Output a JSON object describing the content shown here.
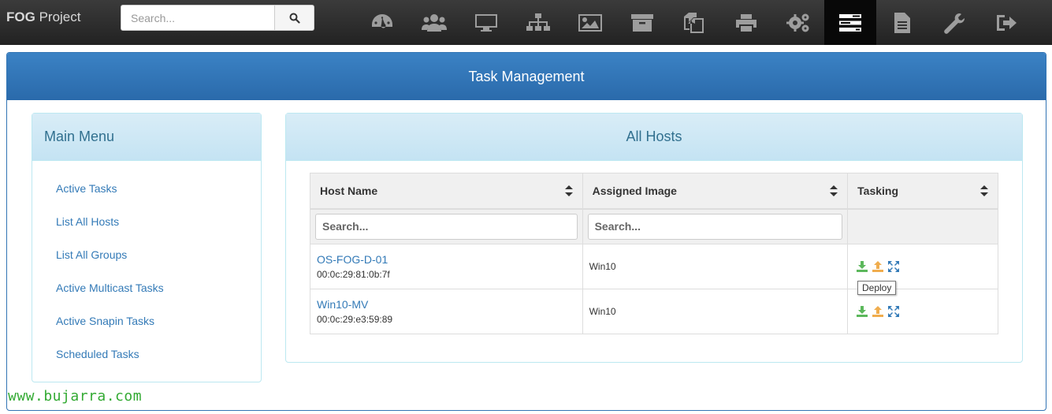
{
  "navbar": {
    "brand_bold": "FOG",
    "brand_rest": " Project",
    "search_placeholder": "Search...",
    "icons": [
      "dashboard-icon",
      "users-icon",
      "hosts-icon",
      "groups-icon",
      "images-icon",
      "storage-icon",
      "snapins-icon",
      "printers-icon",
      "services-icon",
      "tasks-icon",
      "reports-icon",
      "settings-icon",
      "logout-icon"
    ],
    "active_icon": "tasks-icon"
  },
  "main": {
    "title": "Task Management"
  },
  "menu": {
    "title": "Main Menu",
    "items": [
      {
        "label": "Active Tasks"
      },
      {
        "label": "List All Hosts"
      },
      {
        "label": "List All Groups"
      },
      {
        "label": "Active Multicast Tasks"
      },
      {
        "label": "Active Snapin Tasks"
      },
      {
        "label": "Scheduled Tasks"
      }
    ]
  },
  "hosts": {
    "title": "All Hosts",
    "columns": [
      "Host Name",
      "Assigned Image",
      "Tasking"
    ],
    "filter_placeholders": [
      "Search...",
      "Search..."
    ],
    "rows": [
      {
        "name": "OS-FOG-D-01",
        "mac": "00:0c:29:81:0b:7f",
        "image": "Win10"
      },
      {
        "name": "Win10-MV",
        "mac": "00:0c:29:e3:59:89",
        "image": "Win10"
      }
    ],
    "tooltip": "Deploy"
  },
  "colors": {
    "deploy": "#5cb85c",
    "capture": "#f0ad4e",
    "advanced": "#337ab7"
  },
  "watermark": "www.bujarra.com"
}
